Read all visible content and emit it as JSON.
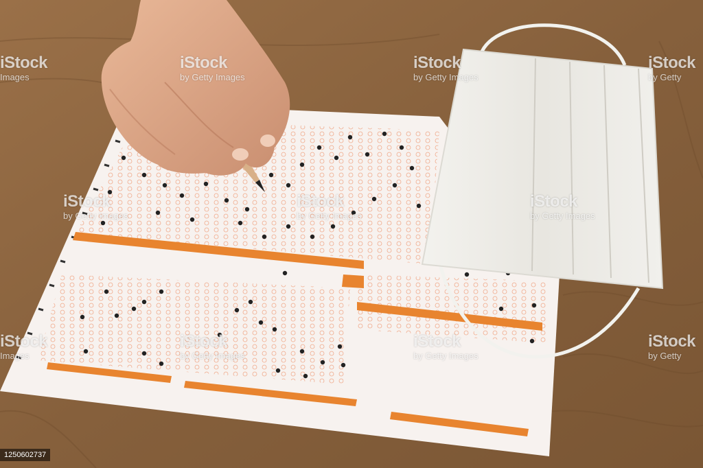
{
  "watermark": {
    "brand": "iStock",
    "credit_short": "by Getty",
    "credit_long": "by Getty Images",
    "brand_alt": "iStock",
    "credit_alt": "Images"
  },
  "stock_id": "1250602737",
  "colors": {
    "table_wood": "#8a6440",
    "answer_sheet_paper": "#f7f2ef",
    "answer_sheet_ink": "#e8842f",
    "pencil_body": "#c8212a",
    "mask": "#efeeea"
  },
  "objects": [
    "hand-icon",
    "pencil-icon",
    "answer-sheet-icon",
    "face-mask-icon"
  ]
}
